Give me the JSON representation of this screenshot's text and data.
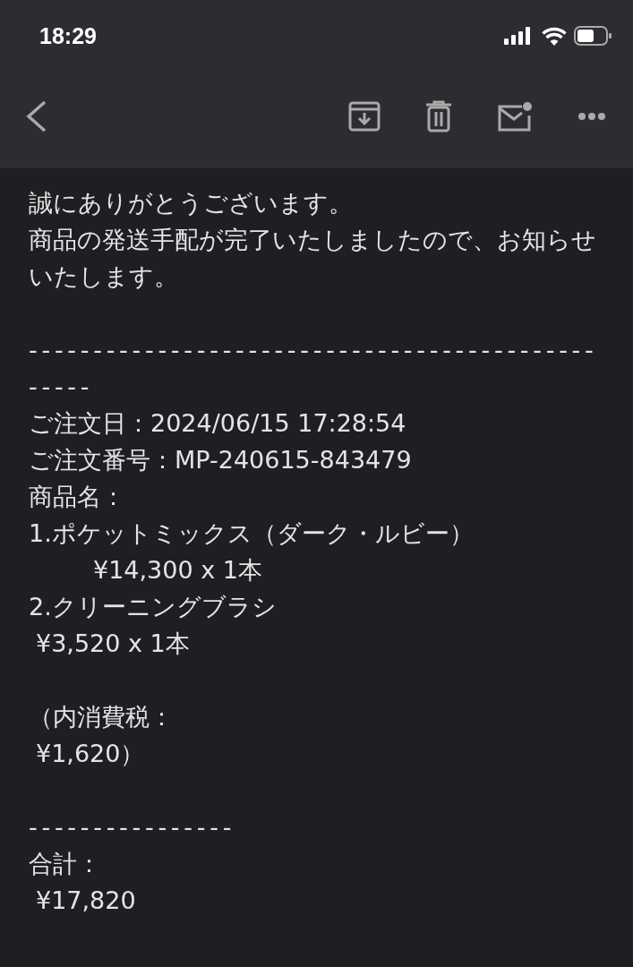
{
  "status_bar": {
    "time": "18:29"
  },
  "toolbar": {
    "actions": [
      {
        "kind": "archive"
      },
      {
        "kind": "trash"
      },
      {
        "kind": "unread"
      },
      {
        "kind": "more"
      }
    ]
  },
  "body": [
    {
      "kind": "text",
      "text": "誠にありがとうございます。"
    },
    {
      "kind": "text",
      "text": "商品の発送手配が完了いたしましたので、お知らせいたします。"
    },
    {
      "kind": "spacer"
    },
    {
      "kind": "rule",
      "text": "-------------------------------------------------"
    },
    {
      "kind": "text",
      "text": "ご注文日：2024/06/15 17:28:54"
    },
    {
      "kind": "text",
      "text": "ご注文番号：MP-240615-843479"
    },
    {
      "kind": "text",
      "text": "商品名："
    },
    {
      "kind": "text",
      "text": "1.ポケットミックス（ダーク・ルビー）"
    },
    {
      "kind": "indent",
      "text": "¥14,300 x 1本"
    },
    {
      "kind": "text",
      "text": "2.クリーニングブラシ"
    },
    {
      "kind": "lead",
      "text": "¥3,520 x 1本"
    },
    {
      "kind": "spacer"
    },
    {
      "kind": "text",
      "text": "（内消費税："
    },
    {
      "kind": "lead",
      "text": "¥1,620）"
    },
    {
      "kind": "spacer"
    },
    {
      "kind": "rule",
      "text": "----------------"
    },
    {
      "kind": "text",
      "text": "合計："
    },
    {
      "kind": "lead",
      "text": "¥17,820"
    }
  ]
}
